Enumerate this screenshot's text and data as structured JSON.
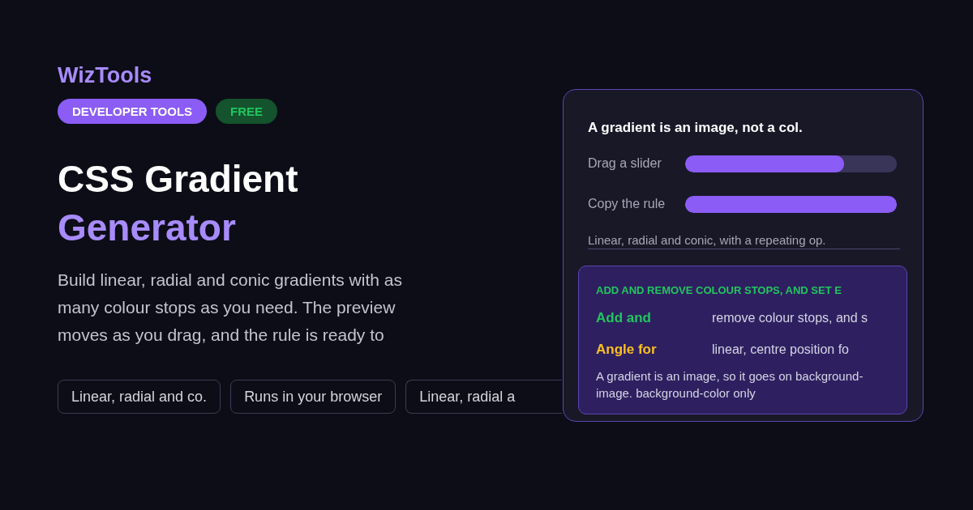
{
  "brand": "WizTools",
  "badges": [
    {
      "label": "DEVELOPER TOOLS",
      "kind": "category"
    },
    {
      "label": "FREE",
      "kind": "price"
    }
  ],
  "title": {
    "line_1": "CSS Gradient",
    "line_2": "Generator"
  },
  "description": "Build linear, radial and conic gradients with as many colour stops as you need. The preview moves as you drag, and the rule is ready to",
  "chips": [
    {
      "label": "Linear, radial and co.",
      "cut": false
    },
    {
      "label": "Runs in your browser",
      "cut": false
    },
    {
      "label": "Linear, radial a",
      "cut": true
    }
  ],
  "card": {
    "heading": "A gradient is an image, not a col.",
    "sliders": [
      {
        "label": "Drag a slider",
        "level": 0.75
      },
      {
        "label": "Copy the rule",
        "level": 1.0
      }
    ],
    "note": "Linear, radial and conic, with a repeating op.",
    "panel": {
      "heading": "ADD AND REMOVE COLOUR STOPS, AND SET E",
      "rows": [
        {
          "label": "Add and",
          "value": "remove colour stops, and s",
          "color": "#22c55e"
        },
        {
          "label": "Angle for",
          "value": "linear, centre position fo",
          "color": "#fbbf24"
        }
      ],
      "text": "A gradient is an image, so it goes on background-image. background-color only"
    }
  }
}
